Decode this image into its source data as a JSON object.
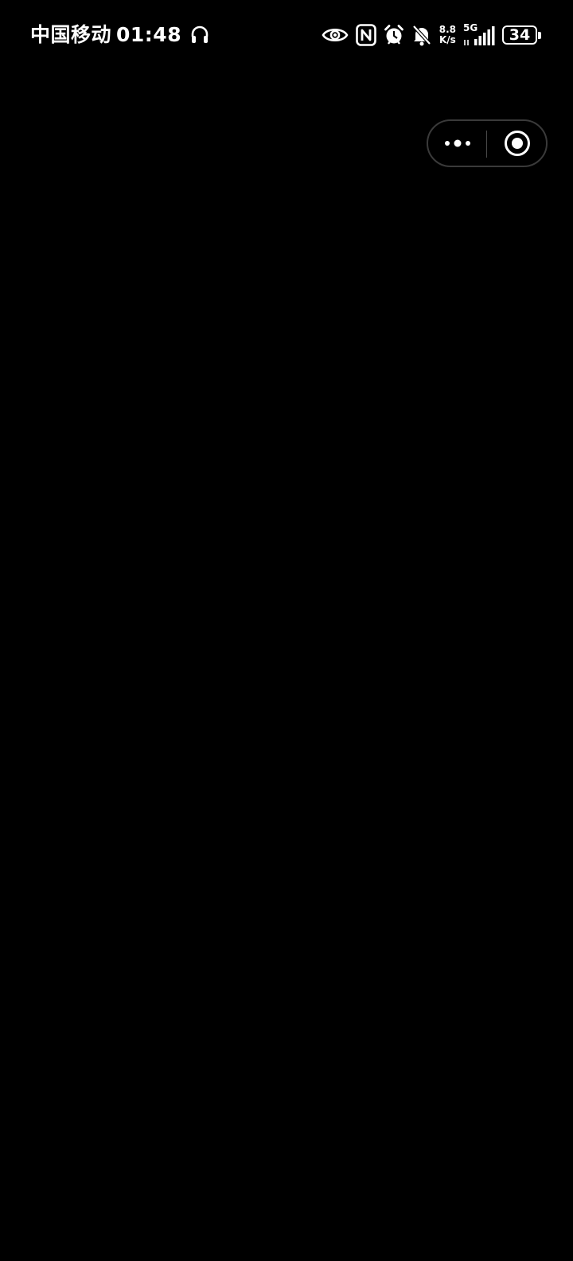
{
  "status_bar": {
    "carrier": "中国移动",
    "time": "01:48",
    "left_icons": [
      "headset-icon"
    ],
    "right_icons": [
      "eye-icon",
      "nfc-icon",
      "alarm-clock-icon",
      "bell-muted-icon",
      "network-speed",
      "signal-5g-icon",
      "battery-icon"
    ],
    "network_speed_value": "8.8",
    "network_speed_unit": "K/s",
    "network_type": "5G",
    "battery_level": "34"
  },
  "capsule": {
    "more_icon": "more-dots-icon",
    "close_icon": "target-close-icon"
  },
  "colors": {
    "background": "#000000",
    "foreground": "#ffffff",
    "capsule_border": "#3a3a3a"
  }
}
